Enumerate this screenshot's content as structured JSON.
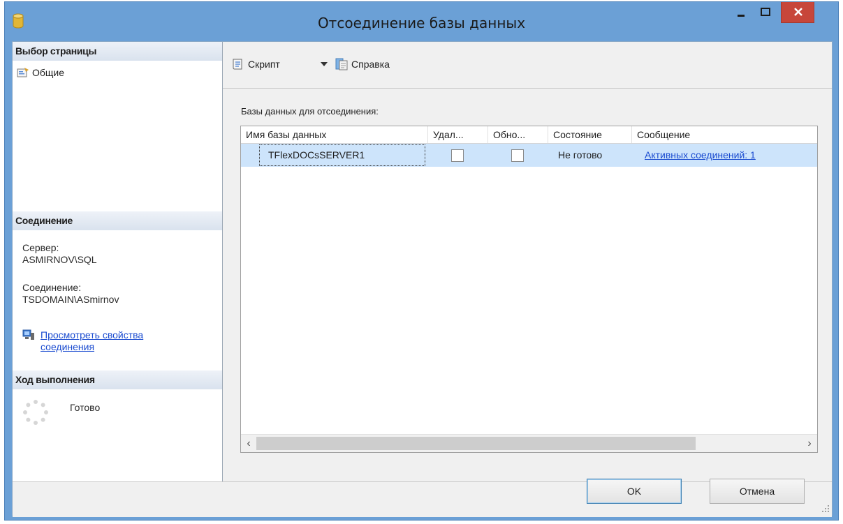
{
  "window": {
    "title": "Отсоединение базы данных"
  },
  "sidebar": {
    "select_page_header": "Выбор страницы",
    "page_item": "Общие",
    "connection_header": "Соединение",
    "server_label": "Сервер:",
    "server_value": "ASMIRNOV\\SQL",
    "connection_label": "Соединение:",
    "connection_value": "TSDOMAIN\\ASmirnov",
    "view_props_line1": "Просмотреть свойства",
    "view_props_line2": "соединения",
    "progress_header": "Ход выполнения",
    "progress_status": "Готово"
  },
  "toolbar": {
    "script_label": "Скрипт",
    "help_label": "Справка"
  },
  "main": {
    "grid_label": "Базы данных для отсоединения:",
    "columns": [
      "Имя базы данных",
      "Удал...",
      "Обно...",
      "Состояние",
      "Сообщение"
    ],
    "rows": [
      {
        "name": "TFlexDOCsSERVER1",
        "drop": false,
        "update": false,
        "status": "Не готово",
        "message": "Активных соединений: 1"
      }
    ]
  },
  "buttons": {
    "ok": "OK",
    "cancel": "Отмена"
  }
}
